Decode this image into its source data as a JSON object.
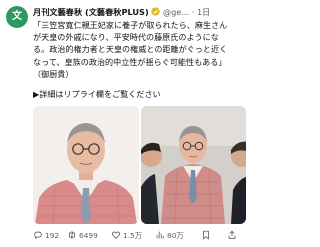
{
  "post": {
    "avatar_text": "文",
    "author_name": "月刊文藝春秋 (文藝春秋PLUS)",
    "verified": true,
    "handle_time": "@ge... · 1日",
    "text_lines": [
      "「三笠宮寛仁親王妃家に養子が取られたら、麻生さん",
      "が天皇の外戚になり、平安時代の藤原氏のようにな",
      "る。政治的権力者と天皇の権威との距離がぐっと近く",
      "なって、皇族の政治的中立性が揺らぐ可能性もある」",
      "（御厨貴）"
    ],
    "link_text": "▶詳細はリプライ欄をご覧ください",
    "images": [
      {
        "description": "elderly man with glasses in pink jacket against white background"
      },
      {
        "description": "three people standing, man in pink plaid jacket in center"
      }
    ]
  },
  "actions": {
    "reply_count": "192",
    "retweet_count": "6499",
    "like_count": "1.5万",
    "views_count": "80万"
  },
  "colors": {
    "avatar_bg": "#2e9a63",
    "verified": "#e2b719",
    "text": "#0f1419",
    "muted": "#536471"
  }
}
